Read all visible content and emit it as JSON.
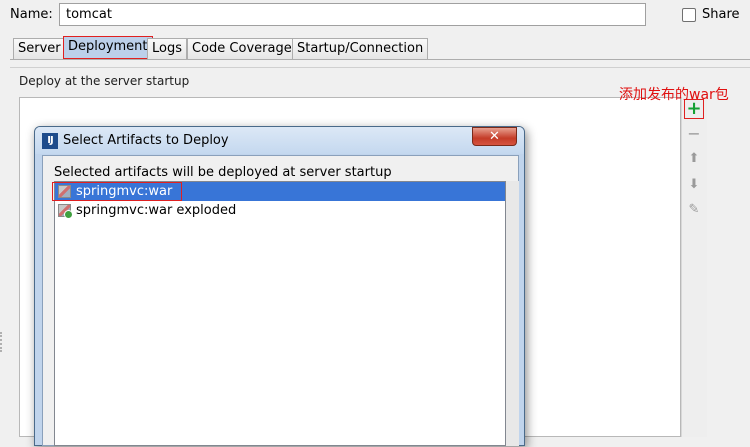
{
  "run_config": {
    "name_label": "Name:",
    "name_value": "tomcat",
    "share_label": "Share",
    "share_checked": false
  },
  "tabs": [
    {
      "label": "Server",
      "active": false
    },
    {
      "label": "Deployment",
      "active": true
    },
    {
      "label": "Logs",
      "active": false
    },
    {
      "label": "Code Coverage",
      "active": false
    },
    {
      "label": "Startup/Connection",
      "active": false
    }
  ],
  "deployment": {
    "group_label": "Deploy at the server startup",
    "toolbar": {
      "add": "+",
      "remove": "−",
      "up": "⬆",
      "down": "⬇",
      "edit": "✎"
    },
    "annotation": "添加发布的war包"
  },
  "dialog": {
    "title": "Select Artifacts to Deploy",
    "close_glyph": "✕",
    "description": "Selected artifacts will be deployed at server startup",
    "artifacts": [
      {
        "label": "springmvc:war",
        "selected": true,
        "icon": "artifact-war-icon"
      },
      {
        "label": "springmvc:war exploded",
        "selected": false,
        "icon": "artifact-exploded-icon"
      }
    ]
  },
  "colors": {
    "selection": "#3875d7",
    "add_icon": "#16a034",
    "annotation": "#e01010"
  }
}
